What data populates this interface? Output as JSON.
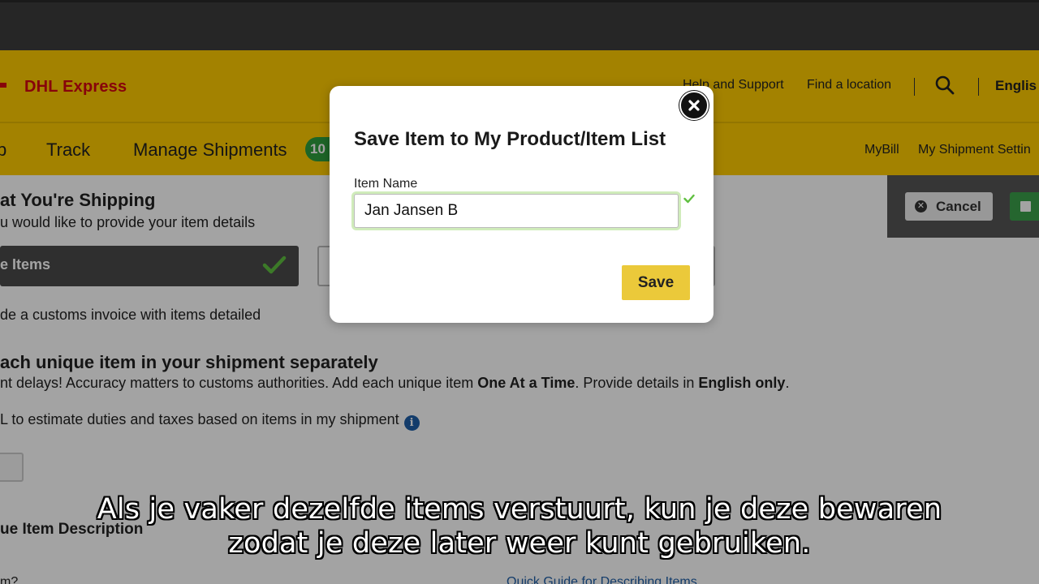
{
  "header": {
    "brand": "DHL Express",
    "links": [
      "Help and Support",
      "Find a location"
    ],
    "language": "Englis"
  },
  "nav": {
    "items": [
      "p",
      "Track",
      "Manage Shipments"
    ],
    "badge": "10",
    "right_links": [
      "MyBill",
      "My Shipment Settin"
    ]
  },
  "page": {
    "section_heading": "at You're Shipping",
    "section_sub": "u would like to provide your item details",
    "option_selected_label": "e Items",
    "customs_text": "de a customs invoice with items detailed",
    "each_item_heading": "ach unique item in your shipment separately",
    "accuracy_prefix": "nt delays! Accuracy matters to customs authorities.  Add each unique item ",
    "accuracy_bold1": "One At a Time",
    "accuracy_mid": ".  Provide details in ",
    "accuracy_bold2": "English only",
    "accuracy_end": ".",
    "estimate_text": "L to estimate duties and taxes based on items in my shipment",
    "info_glyph": "i",
    "description_heading": "ue Item Description",
    "question_text": "m?",
    "guide_link": "Quick Guide for Describing Items"
  },
  "actions": {
    "cancel_label": "Cancel"
  },
  "modal": {
    "title": "Save Item to My Product/Item List",
    "item_name_label": "Item Name",
    "item_name_value": "Jan Jansen B",
    "save_label": "Save"
  },
  "subtitles": {
    "line1": "Als je vaker dezelfde items verstuurt, kun je deze bewaren",
    "line2": "zodat je deze later weer kunt gebruiken."
  },
  "colors": {
    "dhl_yellow": "#ffcc00",
    "dhl_red": "#d40511",
    "save_yellow": "#ebc93a",
    "success_green": "#3aa04a"
  },
  "icons": [
    "search-icon",
    "check-icon",
    "info-icon",
    "close-icon",
    "cancel-x-icon",
    "save-disk-icon"
  ]
}
